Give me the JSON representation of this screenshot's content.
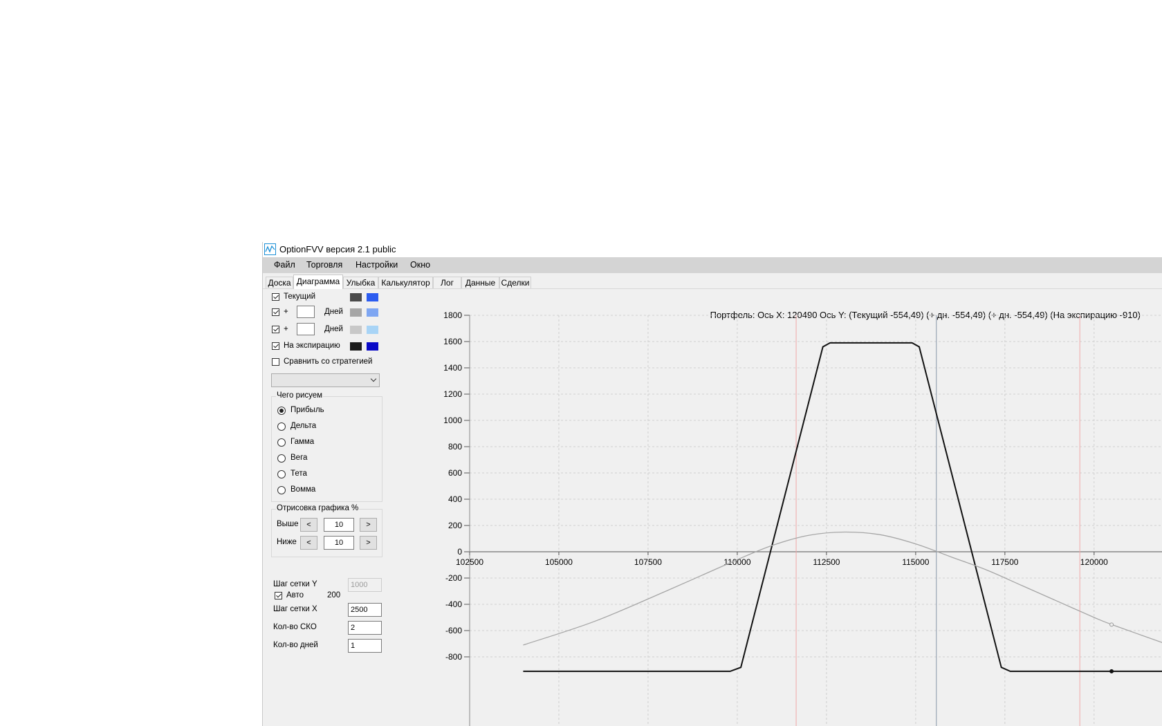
{
  "window": {
    "title": "OptionFVV версия 2.1 public"
  },
  "menu": [
    "Файл",
    "Торговля",
    "Настройки",
    "Окно"
  ],
  "tabs": [
    {
      "label": "Доска",
      "active": false
    },
    {
      "label": "Диаграмма",
      "active": true
    },
    {
      "label": "Улыбка",
      "active": false
    },
    {
      "label": "Калькулятор",
      "active": false
    },
    {
      "label": "Лог",
      "active": false
    },
    {
      "label": "Данные",
      "active": false
    },
    {
      "label": "Сделки",
      "active": false
    }
  ],
  "left_panel": {
    "current": {
      "label": "Текущий",
      "checked": true,
      "color1": "#4a4a4a",
      "color2": "#2c5cf0"
    },
    "plus1": {
      "plus": "+",
      "days_label": "Дней",
      "days_value": "",
      "checked": true,
      "color1": "#a6a6a6",
      "color2": "#7ea6f2"
    },
    "plus2": {
      "plus": "+",
      "days_label": "Дней",
      "days_value": "",
      "checked": true,
      "color1": "#c8c8c8",
      "color2": "#a8d4f6"
    },
    "expiration": {
      "label": "На экспирацию",
      "checked": true,
      "color1": "#1c1c1c",
      "color2": "#0a0ac8"
    },
    "compare": {
      "label": "Сравнить со стратегией",
      "checked": false
    },
    "strategy_select": "",
    "draw_group": {
      "title": "Чего рисуем",
      "options": [
        "Прибыль",
        "Дельта",
        "Гамма",
        "Вега",
        "Тета",
        "Вомма"
      ],
      "selected": "Прибыль"
    },
    "range_group": {
      "title": "Отрисовка графика %",
      "above_label": "Выше",
      "below_label": "Ниже",
      "above_value": "10",
      "below_value": "10",
      "dec": "<",
      "inc": ">"
    },
    "grid_y_label": "Шаг сетки Y",
    "grid_y_value": "1000",
    "auto_label": "Авто",
    "auto_checked": true,
    "auto_value": "200",
    "grid_x_label": "Шаг сетки X",
    "grid_x_value": "2500",
    "sko_label": "Кол-во СКО",
    "sko_value": "2",
    "days_label": "Кол-во дней",
    "days_value": "1"
  },
  "chart_info": "Портфель: Ось X: 120490 Ось Y:  (Текущий -554,49)  (+ дн. -554,49)  (+ дн. -554,49)  (На экспирацию -910)",
  "chart_data": {
    "type": "line",
    "xlim": [
      102500,
      122000
    ],
    "ylim": [
      -950,
      1800
    ],
    "x_ticks": [
      102500,
      105000,
      107500,
      110000,
      112500,
      115000,
      117500,
      120000
    ],
    "y_ticks": [
      1800,
      1600,
      1400,
      1200,
      1000,
      800,
      600,
      400,
      200,
      0,
      -200,
      -400,
      -600,
      -800
    ],
    "grid": true,
    "vertical_lines": [
      {
        "x": 111650,
        "color": "#f0a8a8"
      },
      {
        "x": 115580,
        "color": "#8896a8"
      },
      {
        "x": 119600,
        "color": "#f0a8a8"
      }
    ],
    "series": [
      {
        "color": "#111111",
        "x": [
          104000,
          109800,
          110100,
          112400,
          112600,
          114900,
          115100,
          117400,
          117650,
          122000
        ],
        "y": [
          -910,
          -910,
          -880,
          1560,
          1590,
          1590,
          1560,
          -880,
          -910,
          -910
        ]
      },
      {
        "color": "#a6a6a6",
        "x": [
          104000,
          106000,
          108000,
          110000,
          111000,
          112000,
          113000,
          114000,
          115000,
          116000,
          117000,
          118000,
          119000,
          120000,
          120500,
          122000
        ],
        "y": [
          -710,
          -530,
          -300,
          -60,
          50,
          125,
          150,
          130,
          60,
          -40,
          -140,
          -260,
          -380,
          -500,
          -554.49,
          -700
        ]
      }
    ],
    "markers": [
      {
        "x": 120490,
        "y": -554.49,
        "color": "#999999"
      },
      {
        "x": 120490,
        "y": -910,
        "color": "#111111"
      }
    ]
  }
}
